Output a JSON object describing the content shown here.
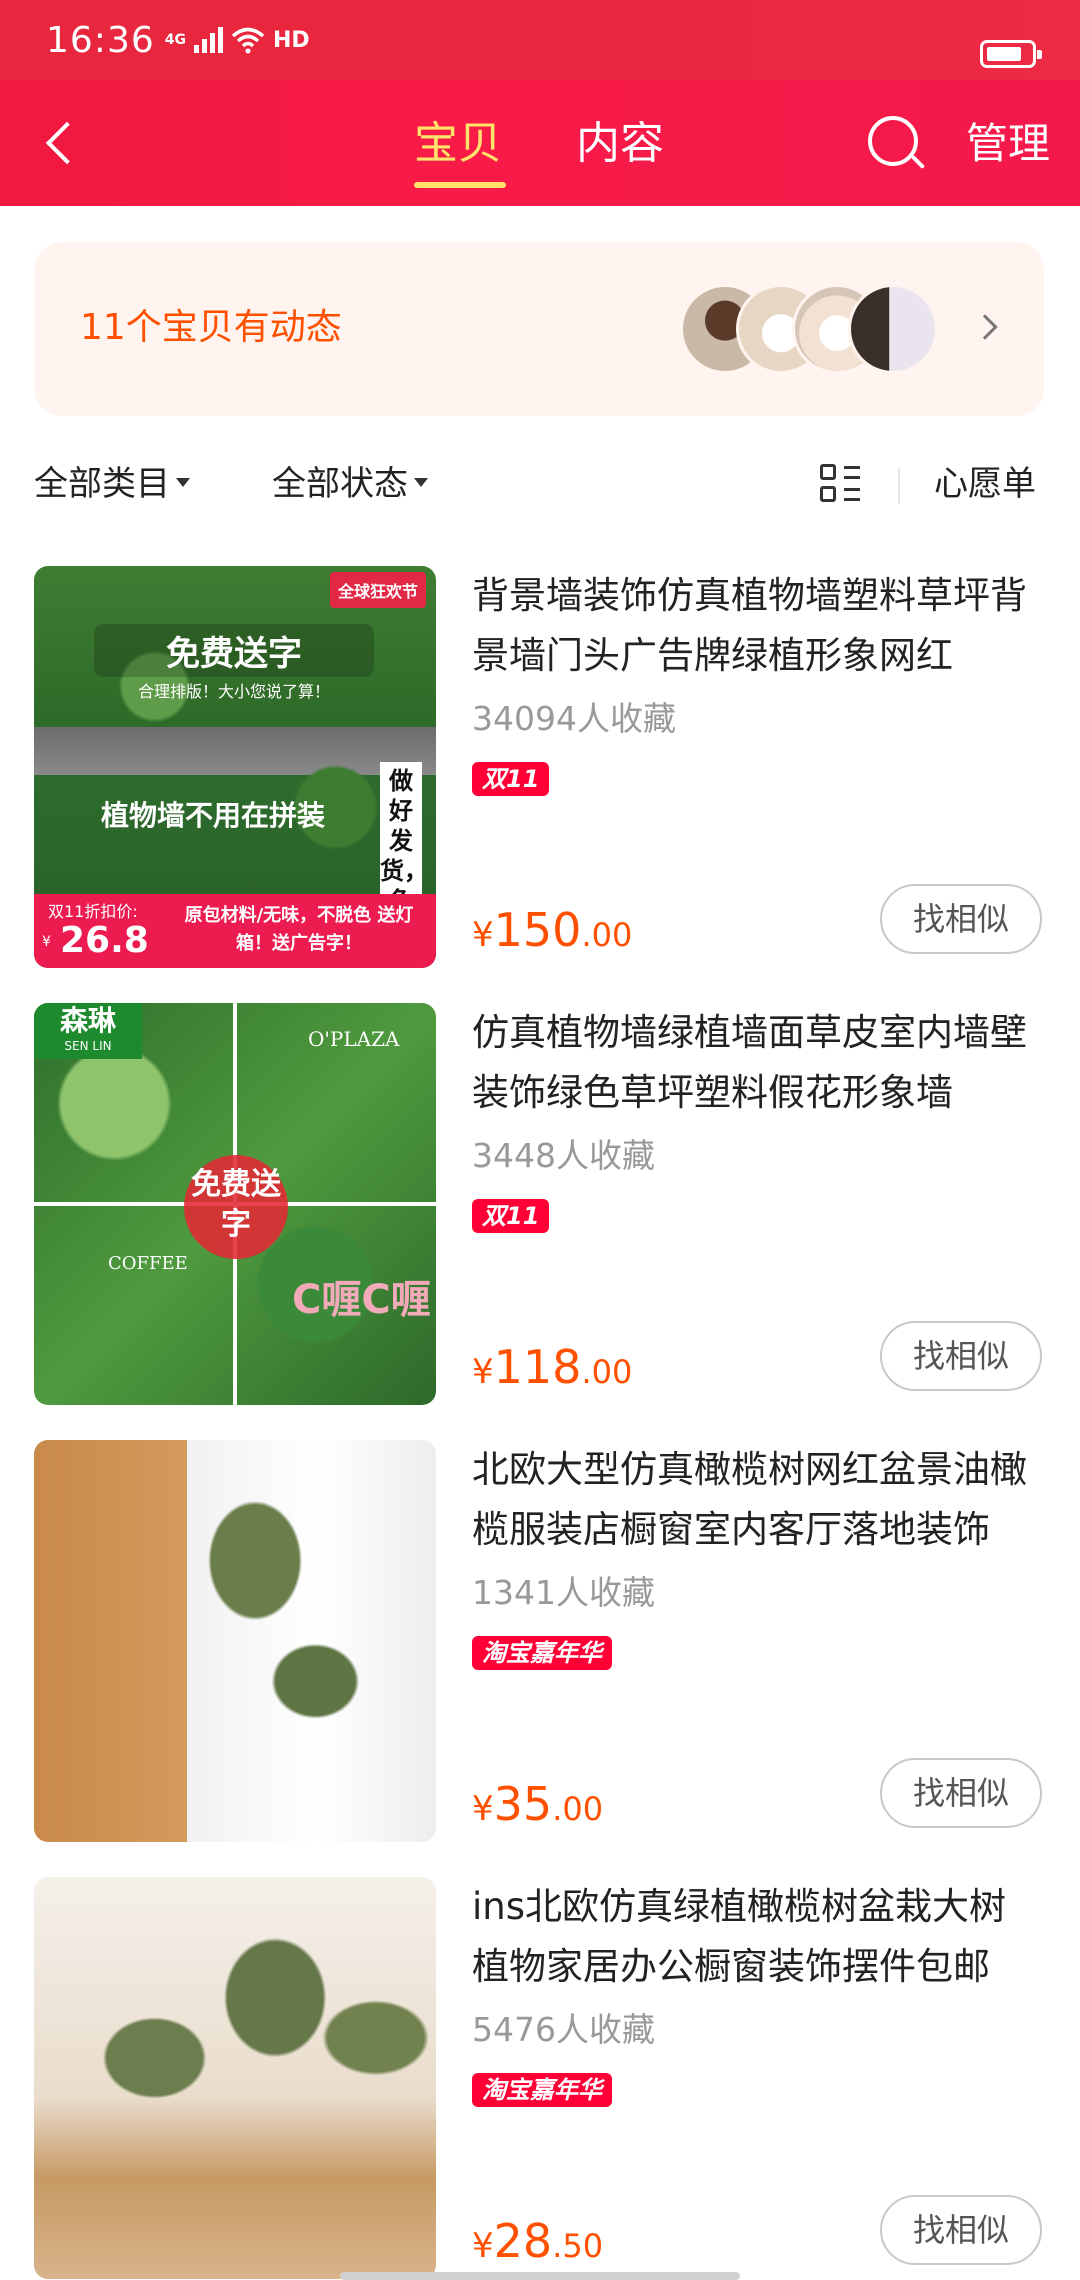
{
  "status_bar": {
    "time": "16:36",
    "network": "4G",
    "hd": "HD"
  },
  "nav": {
    "tabs": [
      {
        "label": "宝贝",
        "active": true
      },
      {
        "label": "内容",
        "active": false
      }
    ],
    "manage_label": "管理",
    "active_color": "#ffe36b",
    "brand_color": "#f81a47"
  },
  "activity": {
    "text": "11个宝贝有动态"
  },
  "filters": {
    "category": "全部类目",
    "status": "全部状态",
    "wishlist": "心愿单"
  },
  "products": [
    {
      "title": "背景墙装饰仿真植物墙塑料草坪背景墙门头广告牌绿植形象网红",
      "favorites": "34094人收藏",
      "badge": "双11",
      "price_currency": "¥",
      "price_int": "150",
      "price_dec": ".00",
      "similar_label": "找相似",
      "image": {
        "corner": "全球狂欢节",
        "headline": "免费送字",
        "sub": "合理排版！大小您说了算！",
        "mid": "植物墙不用在拼装",
        "side": "做好发货，免",
        "tag_label": "双11折扣价:",
        "tag_value": "26.8",
        "tag_currency": "¥",
        "promo": "原包材料/无味，不脱色 送灯箱！送广告字！"
      }
    },
    {
      "title": "仿真植物墙绿植墙面草皮室内墙壁装饰绿色草坪塑料假花形象墙",
      "favorites": "3448人收藏",
      "badge": "双11",
      "price_currency": "¥",
      "price_int": "118",
      "price_dec": ".00",
      "similar_label": "找相似",
      "image": {
        "brand": "森琳",
        "brand_sub": "SEN LIN",
        "free": "免费送字",
        "coffee": "COFFEE",
        "oplaza": "O'PLAZA",
        "cafe": "C喱C喱"
      }
    },
    {
      "title": "北欧大型仿真橄榄树网红盆景油橄榄服装店橱窗室内客厅落地装饰",
      "favorites": "1341人收藏",
      "badge": "淘宝嘉年华",
      "price_currency": "¥",
      "price_int": "35",
      "price_dec": ".00",
      "similar_label": "找相似"
    },
    {
      "title": "ins北欧仿真绿植橄榄树盆栽大树植物家居办公橱窗装饰摆件包邮",
      "favorites": "5476人收藏",
      "badge": "淘宝嘉年华",
      "price_currency": "¥",
      "price_int": "28",
      "price_dec": ".50",
      "similar_label": "找相似"
    }
  ],
  "colors": {
    "price": "#ff5000",
    "badge": "#ff0036",
    "activity_bg": "#fff4ef"
  }
}
